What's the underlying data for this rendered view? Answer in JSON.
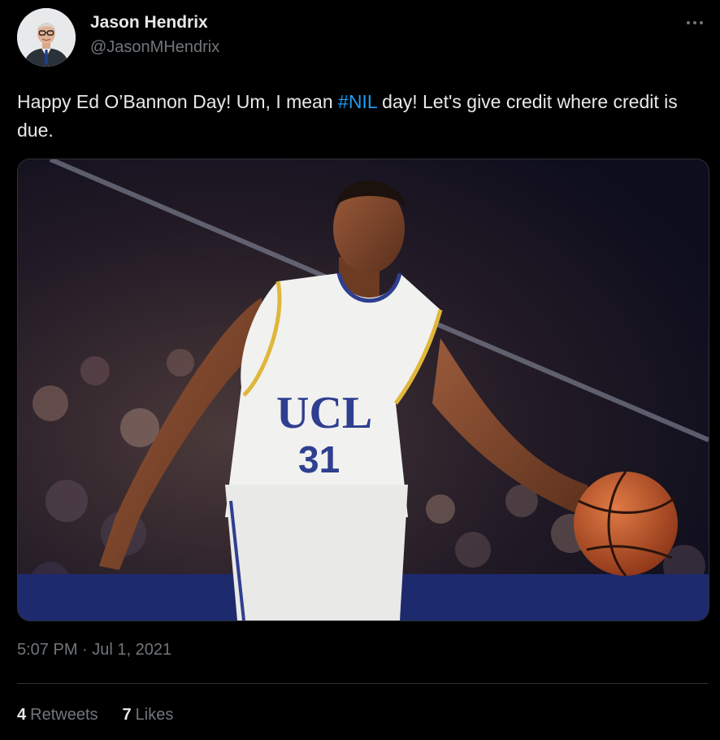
{
  "author": {
    "name": "Jason Hendrix",
    "handle": "@JasonMHendrix"
  },
  "tweet": {
    "text_before": "Happy Ed O’Bannon Day! Um, I mean ",
    "hashtag": "#NIL",
    "text_after": " day! Let's give credit where credit is due."
  },
  "media": {
    "jersey_text": "UCL",
    "jersey_number": "31"
  },
  "timestamp": "5:07 PM · Jul 1, 2021",
  "stats": {
    "retweets_count": "4",
    "retweets_label": "Retweets",
    "likes_count": "7",
    "likes_label": "Likes"
  },
  "colors": {
    "background": "#000000",
    "text": "#e7e9ea",
    "secondary": "#71767b",
    "link": "#1d9bf0"
  },
  "icons": {
    "more": "more-horizontal-icon"
  }
}
